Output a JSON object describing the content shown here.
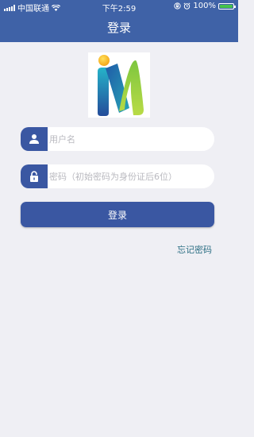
{
  "status_bar": {
    "carrier": "中国联通",
    "time": "下午2:59",
    "battery_percent": "100%"
  },
  "nav": {
    "title": "登录"
  },
  "form": {
    "username_placeholder": "用户名",
    "password_placeholder": "密码（初始密码为身份证后6位）",
    "login_label": "登录",
    "forgot_label": "忘记密码"
  },
  "colors": {
    "primary": "#3a57a2",
    "header": "#3f62a7",
    "background": "#efeff4",
    "link": "#2d6f84"
  },
  "icons": [
    "signal-icon",
    "wifi-icon",
    "lock-rotation-icon",
    "alarm-icon",
    "battery-icon",
    "user-icon",
    "lock-icon"
  ]
}
